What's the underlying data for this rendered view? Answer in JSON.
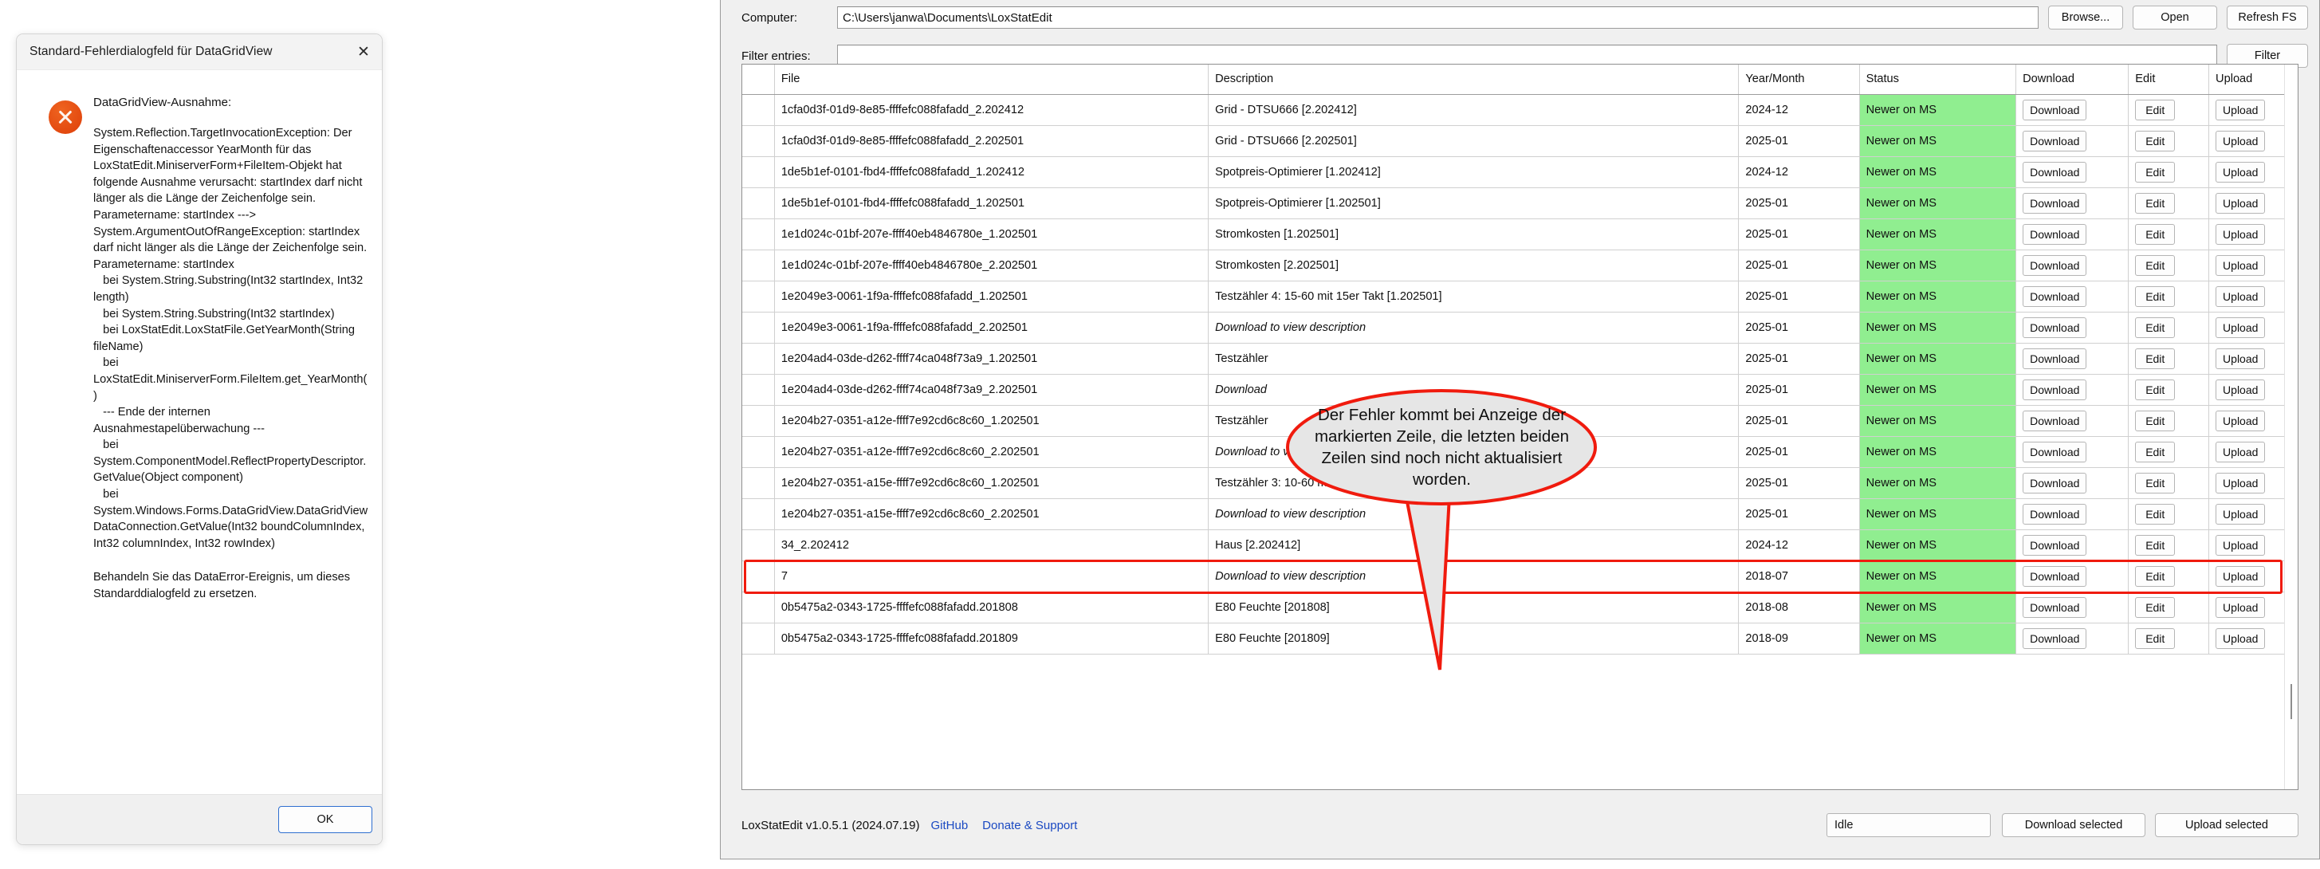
{
  "dialog": {
    "title": "Standard-Fehlerdialogfeld für DataGridView",
    "close_icon": "close-icon",
    "error_icon": "error-circle-icon",
    "heading": "DataGridView-Ausnahme:",
    "trace": "System.Reflection.TargetInvocationException: Der Eigenschaftenaccessor YearMonth für das LoxStatEdit.MiniserverForm+FileItem-Objekt hat folgende Ausnahme verursacht: startIndex darf nicht länger als die Länge der Zeichenfolge sein.\nParametername: startIndex --->\nSystem.ArgumentOutOfRangeException: startIndex darf nicht länger als die Länge der Zeichenfolge sein.\nParametername: startIndex\n   bei System.String.Substring(Int32 startIndex, Int32 length)\n   bei System.String.Substring(Int32 startIndex)\n   bei LoxStatEdit.LoxStatFile.GetYearMonth(String fileName)\n   bei LoxStatEdit.MiniserverForm.FileItem.get_YearMonth()\n   --- Ende der internen Ausnahmestapelüberwachung ---\n   bei System.ComponentModel.ReflectPropertyDescriptor.GetValue(Object component)\n   bei System.Windows.Forms.DataGridView.DataGridViewDataConnection.GetValue(Int32 boundColumnIndex, Int32 columnIndex, Int32 rowIndex)",
    "footnote": "Behandeln Sie das DataError-Ereignis, um dieses Standarddialogfeld zu ersetzen.",
    "ok_label": "OK"
  },
  "toolbar": {
    "computer_label": "Computer:",
    "computer_value": "C:\\Users\\janwa\\Documents\\LoxStatEdit",
    "filter_label": "Filter entries:",
    "filter_value": "",
    "browse_label": "Browse...",
    "open_label": "Open",
    "refresh_label": "Refresh FS",
    "filter_button_label": "Filter"
  },
  "grid": {
    "columns": [
      "",
      "File",
      "Description",
      "Year/Month",
      "Status",
      "Download",
      "Edit",
      "Upload"
    ],
    "rows": [
      {
        "file": "1cfa0d3f-01d9-8e85-ffffefc088fafadd_2.202412",
        "desc": "Grid - DTSU666 [2.202412]",
        "desc_italic": false,
        "ym": "2024-12",
        "status": "Newer on MS",
        "download": "Download",
        "edit": "Edit",
        "upload": "Upload",
        "highlight": false
      },
      {
        "file": "1cfa0d3f-01d9-8e85-ffffefc088fafadd_2.202501",
        "desc": "Grid - DTSU666 [2.202501]",
        "desc_italic": false,
        "ym": "2025-01",
        "status": "Newer on MS",
        "download": "Download",
        "edit": "Edit",
        "upload": "Upload",
        "highlight": false
      },
      {
        "file": "1de5b1ef-0101-fbd4-ffffefc088fafadd_1.202412",
        "desc": "Spotpreis-Optimierer [1.202412]",
        "desc_italic": false,
        "ym": "2024-12",
        "status": "Newer on MS",
        "download": "Download",
        "edit": "Edit",
        "upload": "Upload",
        "highlight": false
      },
      {
        "file": "1de5b1ef-0101-fbd4-ffffefc088fafadd_1.202501",
        "desc": "Spotpreis-Optimierer [1.202501]",
        "desc_italic": false,
        "ym": "2025-01",
        "status": "Newer on MS",
        "download": "Download",
        "edit": "Edit",
        "upload": "Upload",
        "highlight": false
      },
      {
        "file": "1e1d024c-01bf-207e-ffff40eb4846780e_1.202501",
        "desc": "Stromkosten [1.202501]",
        "desc_italic": false,
        "ym": "2025-01",
        "status": "Newer on MS",
        "download": "Download",
        "edit": "Edit",
        "upload": "Upload",
        "highlight": false
      },
      {
        "file": "1e1d024c-01bf-207e-ffff40eb4846780e_2.202501",
        "desc": "Stromkosten [2.202501]",
        "desc_italic": false,
        "ym": "2025-01",
        "status": "Newer on MS",
        "download": "Download",
        "edit": "Edit",
        "upload": "Upload",
        "highlight": false
      },
      {
        "file": "1e2049e3-0061-1f9a-ffffefc088fafadd_1.202501",
        "desc": "Testzähler 4: 15-60 mit 15er Takt [1.202501]",
        "desc_italic": false,
        "ym": "2025-01",
        "status": "Newer on MS",
        "download": "Download",
        "edit": "Edit",
        "upload": "Upload",
        "highlight": false
      },
      {
        "file": "1e2049e3-0061-1f9a-ffffefc088fafadd_2.202501",
        "desc": "Download to view description",
        "desc_italic": true,
        "ym": "2025-01",
        "status": "Newer on MS",
        "download": "Download",
        "edit": "Edit",
        "upload": "Upload",
        "highlight": false
      },
      {
        "file": "1e204ad4-03de-d262-ffff74ca048f73a9_1.202501",
        "desc": "Testzähler",
        "desc_italic": false,
        "ym": "2025-01",
        "status": "Newer on MS",
        "download": "Download",
        "edit": "Edit",
        "upload": "Upload",
        "highlight": false
      },
      {
        "file": "1e204ad4-03de-d262-ffff74ca048f73a9_2.202501",
        "desc": "Download",
        "desc_italic": true,
        "ym": "2025-01",
        "status": "Newer on MS",
        "download": "Download",
        "edit": "Edit",
        "upload": "Upload",
        "highlight": false
      },
      {
        "file": "1e204b27-0351-a12e-ffff7e92cd6c8c60_1.202501",
        "desc": "Testzähler",
        "desc_italic": false,
        "ym": "2025-01",
        "status": "Newer on MS",
        "download": "Download",
        "edit": "Edit",
        "upload": "Upload",
        "highlight": false
      },
      {
        "file": "1e204b27-0351-a12e-ffff7e92cd6c8c60_2.202501",
        "desc": "Download to view de",
        "desc_italic": true,
        "ym": "2025-01",
        "status": "Newer on MS",
        "download": "Download",
        "edit": "Edit",
        "upload": "Upload",
        "highlight": false
      },
      {
        "file": "1e204b27-0351-a15e-ffff7e92cd6c8c60_1.202501",
        "desc": "Testzähler 3: 10-60 mit 20er Takt [1.202501]",
        "desc_italic": false,
        "ym": "2025-01",
        "status": "Newer on MS",
        "download": "Download",
        "edit": "Edit",
        "upload": "Upload",
        "highlight": false
      },
      {
        "file": "1e204b27-0351-a15e-ffff7e92cd6c8c60_2.202501",
        "desc": "Download to view description",
        "desc_italic": true,
        "ym": "2025-01",
        "status": "Newer on MS",
        "download": "Download",
        "edit": "Edit",
        "upload": "Upload",
        "highlight": false
      },
      {
        "file": "34_2.202412",
        "desc": "Haus [2.202412]",
        "desc_italic": false,
        "ym": "2024-12",
        "status": "Newer on MS",
        "download": "Download",
        "edit": "Edit",
        "upload": "Upload",
        "highlight": false
      },
      {
        "file": "7",
        "desc": "Download to view description",
        "desc_italic": true,
        "ym": "2018-07",
        "status": "Newer on MS",
        "download": "Download",
        "edit": "Edit",
        "upload": "Upload",
        "highlight": true
      },
      {
        "file": "0b5475a2-0343-1725-ffffefc088fafadd.201808",
        "desc": "E80 Feuchte [201808]",
        "desc_italic": false,
        "ym": "2018-08",
        "status": "Newer on MS",
        "download": "Download",
        "edit": "Edit",
        "upload": "Upload",
        "highlight": false
      },
      {
        "file": "0b5475a2-0343-1725-ffffefc088fafadd.201809",
        "desc": "E80 Feuchte [201809]",
        "desc_italic": false,
        "ym": "2018-09",
        "status": "Newer on MS",
        "download": "Download",
        "edit": "Edit",
        "upload": "Upload",
        "highlight": false
      }
    ]
  },
  "statusbar": {
    "version": "LoxStatEdit v1.0.5.1 (2024.07.19)",
    "github_label": "GitHub",
    "donate_label": "Donate & Support",
    "state": "Idle",
    "download_selected_label": "Download selected",
    "upload_selected_label": "Upload selected"
  },
  "callout": {
    "text": "Der Fehler kommt bei Anzeige der markierten Zeile, die letzten beiden Zeilen sind noch nicht aktualisiert worden.",
    "outline_color": "#f01b0e",
    "fill_color": "#e6e6e6"
  },
  "colors": {
    "status_green": "#90ee90",
    "link_blue": "#1a49c2",
    "error_orange": "#e2480f",
    "annotation_red": "#f01b0e"
  }
}
